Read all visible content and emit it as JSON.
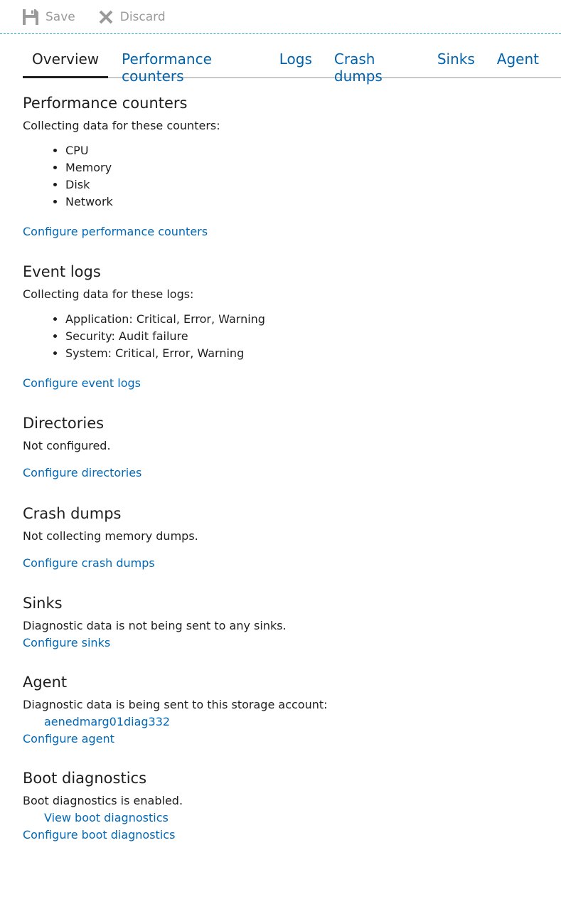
{
  "toolbar": {
    "save_label": "Save",
    "discard_label": "Discard"
  },
  "tabs": [
    {
      "label": "Overview"
    },
    {
      "label": "Performance counters"
    },
    {
      "label": "Logs"
    },
    {
      "label": "Crash dumps"
    },
    {
      "label": "Sinks"
    },
    {
      "label": "Agent"
    }
  ],
  "sections": {
    "performance": {
      "title": "Performance counters",
      "desc": "Collecting data for these counters:",
      "items": [
        "CPU",
        "Memory",
        "Disk",
        "Network"
      ],
      "link": "Configure performance counters"
    },
    "eventlogs": {
      "title": "Event logs",
      "desc": "Collecting data for these logs:",
      "items": [
        "Application: Critical, Error, Warning",
        "Security: Audit failure",
        "System: Critical, Error, Warning"
      ],
      "link": "Configure event logs"
    },
    "directories": {
      "title": "Directories",
      "desc": "Not configured.",
      "link": "Configure directories"
    },
    "crashdumps": {
      "title": "Crash dumps",
      "desc": "Not collecting memory dumps.",
      "link": "Configure crash dumps"
    },
    "sinks": {
      "title": "Sinks",
      "desc": "Diagnostic data is not being sent to any sinks.",
      "link": "Configure sinks"
    },
    "agent": {
      "title": "Agent",
      "desc": "Diagnostic data is being sent to this storage account:",
      "account_link": "aenedmarg01diag332",
      "link": "Configure agent"
    },
    "boot": {
      "title": "Boot diagnostics",
      "desc": "Boot diagnostics is enabled.",
      "view_link": "View boot diagnostics",
      "link": "Configure boot diagnostics"
    }
  },
  "colors": {
    "link": "#0069b8",
    "tab_link": "#0062ad",
    "text": "#1e1e1e",
    "disabled": "#9a9a9a",
    "divider": "#2aa6c6"
  }
}
